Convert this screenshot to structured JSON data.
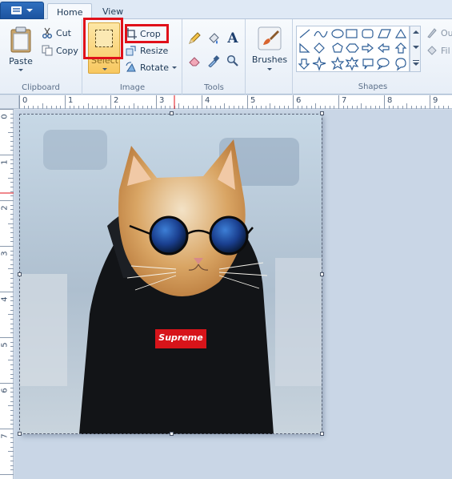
{
  "tabs": {
    "file_menu": "",
    "home": "Home",
    "view": "View"
  },
  "clipboard": {
    "paste": "Paste",
    "cut": "Cut",
    "copy": "Copy",
    "group_label": "Clipboard"
  },
  "image": {
    "select": "Select",
    "crop": "Crop",
    "resize": "Resize",
    "rotate": "Rotate",
    "group_label": "Image"
  },
  "tools": {
    "group_label": "Tools",
    "items": [
      "pencil-icon",
      "fill-bucket-icon",
      "text-icon",
      "eraser-icon",
      "color-picker-icon",
      "magnifier-icon"
    ]
  },
  "brushes": {
    "label": "Brushes"
  },
  "shapes": {
    "group_label": "Shapes",
    "outline": "Ou",
    "fill": "Fil"
  },
  "ruler": {
    "h_marks": [
      "0",
      "1",
      "2",
      "3",
      "4",
      "5",
      "6",
      "7",
      "8",
      "9"
    ],
    "v_marks": [
      "0",
      "1",
      "2",
      "3",
      "4",
      "5",
      "6",
      "7"
    ]
  },
  "canvas": {
    "logo_text": "Supreme"
  },
  "colors": {
    "highlight": "#e0101a",
    "ribbon_bg": "#f7fafd",
    "file_button": "#2f6fbf"
  }
}
